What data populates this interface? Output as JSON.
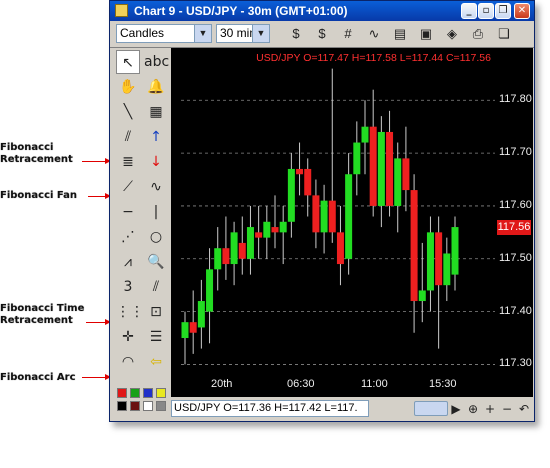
{
  "annotations": [
    {
      "text": "Fibonacci\nRetracement"
    },
    {
      "text": "Fibonacci Fan"
    },
    {
      "text": "Fibonacci Time\nRetracement"
    },
    {
      "text": "Fibonacci Arc"
    }
  ],
  "window": {
    "title": "Chart 9 - USD/JPY - 30m (GMT+01:00)",
    "buttons": [
      "_",
      "▫",
      "❐",
      "✕"
    ]
  },
  "toolbar": {
    "chart_type": "Candles",
    "period": "30 min"
  },
  "chart": {
    "info_line": "USD/JPY O=117.47 H=117.58 L=117.44 C=117.56",
    "last_price": "117.56",
    "colors": {
      "bull": "#22dd22",
      "bear": "#ee2020",
      "grid": "#888888",
      "background": "#000000"
    }
  },
  "chart_data": {
    "type": "candlestick",
    "ylim": [
      117.28,
      117.88
    ],
    "y_ticks": [
      "117.80",
      "117.70",
      "117.60",
      "117.50",
      "117.40",
      "117.30"
    ],
    "x_ticks": [
      "20th",
      "06:30",
      "11:00",
      "15:30"
    ],
    "candles": [
      {
        "o": 117.35,
        "h": 117.4,
        "l": 117.3,
        "c": 117.38
      },
      {
        "o": 117.38,
        "h": 117.44,
        "l": 117.32,
        "c": 117.36
      },
      {
        "o": 117.37,
        "h": 117.46,
        "l": 117.33,
        "c": 117.42
      },
      {
        "o": 117.4,
        "h": 117.52,
        "l": 117.34,
        "c": 117.48
      },
      {
        "o": 117.48,
        "h": 117.56,
        "l": 117.44,
        "c": 117.52
      },
      {
        "o": 117.52,
        "h": 117.58,
        "l": 117.46,
        "c": 117.49
      },
      {
        "o": 117.49,
        "h": 117.57,
        "l": 117.45,
        "c": 117.55
      },
      {
        "o": 117.53,
        "h": 117.58,
        "l": 117.47,
        "c": 117.5
      },
      {
        "o": 117.5,
        "h": 117.6,
        "l": 117.47,
        "c": 117.56
      },
      {
        "o": 117.55,
        "h": 117.6,
        "l": 117.5,
        "c": 117.54
      },
      {
        "o": 117.54,
        "h": 117.6,
        "l": 117.5,
        "c": 117.57
      },
      {
        "o": 117.56,
        "h": 117.62,
        "l": 117.52,
        "c": 117.55
      },
      {
        "o": 117.55,
        "h": 117.6,
        "l": 117.49,
        "c": 117.57
      },
      {
        "o": 117.57,
        "h": 117.7,
        "l": 117.54,
        "c": 117.67
      },
      {
        "o": 117.67,
        "h": 117.72,
        "l": 117.62,
        "c": 117.66
      },
      {
        "o": 117.67,
        "h": 117.69,
        "l": 117.58,
        "c": 117.62
      },
      {
        "o": 117.62,
        "h": 117.65,
        "l": 117.52,
        "c": 117.55
      },
      {
        "o": 117.55,
        "h": 117.64,
        "l": 117.51,
        "c": 117.61
      },
      {
        "o": 117.61,
        "h": 117.86,
        "l": 117.53,
        "c": 117.55
      },
      {
        "o": 117.55,
        "h": 117.6,
        "l": 117.45,
        "c": 117.49
      },
      {
        "o": 117.5,
        "h": 117.7,
        "l": 117.47,
        "c": 117.66
      },
      {
        "o": 117.66,
        "h": 117.76,
        "l": 117.62,
        "c": 117.72
      },
      {
        "o": 117.72,
        "h": 117.8,
        "l": 117.66,
        "c": 117.75
      },
      {
        "o": 117.75,
        "h": 117.82,
        "l": 117.58,
        "c": 117.6
      },
      {
        "o": 117.6,
        "h": 117.77,
        "l": 117.56,
        "c": 117.74
      },
      {
        "o": 117.74,
        "h": 117.78,
        "l": 117.58,
        "c": 117.6
      },
      {
        "o": 117.6,
        "h": 117.72,
        "l": 117.55,
        "c": 117.69
      },
      {
        "o": 117.69,
        "h": 117.75,
        "l": 117.59,
        "c": 117.63
      },
      {
        "o": 117.63,
        "h": 117.66,
        "l": 117.36,
        "c": 117.42
      },
      {
        "o": 117.42,
        "h": 117.53,
        "l": 117.38,
        "c": 117.44
      },
      {
        "o": 117.44,
        "h": 117.58,
        "l": 117.4,
        "c": 117.55
      },
      {
        "o": 117.55,
        "h": 117.58,
        "l": 117.33,
        "c": 117.45
      },
      {
        "o": 117.45,
        "h": 117.54,
        "l": 117.42,
        "c": 117.51
      },
      {
        "o": 117.47,
        "h": 117.58,
        "l": 117.44,
        "c": 117.56
      }
    ]
  },
  "status": {
    "ohlc": "USD/JPY O=117.36 H=117.42 L=117.",
    "buttons": [
      "▶",
      "⊕",
      "+",
      "−",
      "↶"
    ]
  },
  "left_tools": [
    {
      "name": "cursor-icon",
      "glyph": "↖"
    },
    {
      "name": "text-tool-icon",
      "glyph": "abc"
    },
    {
      "name": "hand-icon",
      "glyph": "✋"
    },
    {
      "name": "bell-icon",
      "glyph": "🔔"
    },
    {
      "name": "line-icon",
      "glyph": "╲"
    },
    {
      "name": "calculator-icon",
      "glyph": "▦"
    },
    {
      "name": "parallel-lines-icon",
      "glyph": "⫽"
    },
    {
      "name": "buy-arrow-icon",
      "glyph": "↑"
    },
    {
      "name": "fibonacci-retracement-icon",
      "glyph": "≣"
    },
    {
      "name": "sell-arrow-icon",
      "glyph": "↓"
    },
    {
      "name": "fibonacci-fan-icon",
      "glyph": "⟋"
    },
    {
      "name": "wave-icon",
      "glyph": "∿"
    },
    {
      "name": "horizontal-line-icon",
      "glyph": "−"
    },
    {
      "name": "vertical-line-icon",
      "glyph": "|"
    },
    {
      "name": "gann-fan-icon",
      "glyph": "⋰"
    },
    {
      "name": "circle-icon",
      "glyph": "○"
    },
    {
      "name": "regression-icon",
      "glyph": "⩘"
    },
    {
      "name": "zoom-icon",
      "glyph": "🔍"
    },
    {
      "name": "channel-icon",
      "glyph": "3"
    },
    {
      "name": "pitchfork-icon",
      "glyph": "⫽"
    },
    {
      "name": "fibonacci-time-icon",
      "glyph": "⋮⋮"
    },
    {
      "name": "zoom-area-icon",
      "glyph": "⊡"
    },
    {
      "name": "crosshair-icon",
      "glyph": "✛"
    },
    {
      "name": "list-icon",
      "glyph": "☰"
    },
    {
      "name": "fibonacci-arc-icon",
      "glyph": "◠"
    },
    {
      "name": "back-arrow-icon",
      "glyph": "⇦"
    }
  ],
  "swatches": [
    "#e01818",
    "#18a018",
    "#2030c8",
    "#e8e820",
    "#000000",
    "#6a1010",
    "#ffffff",
    "#888888"
  ],
  "toolbar_icons": [
    {
      "name": "currency-icon",
      "glyph": "$"
    },
    {
      "name": "currency-alt-icon",
      "glyph": "$"
    },
    {
      "name": "grid-icon",
      "glyph": "#"
    },
    {
      "name": "indicator-icon",
      "glyph": "∿"
    },
    {
      "name": "report-icon",
      "glyph": "▤"
    },
    {
      "name": "template-icon",
      "glyph": "▣"
    },
    {
      "name": "book-icon",
      "glyph": "◈"
    },
    {
      "name": "print-icon",
      "glyph": "⎙"
    },
    {
      "name": "copy-icon",
      "glyph": "❏"
    }
  ]
}
